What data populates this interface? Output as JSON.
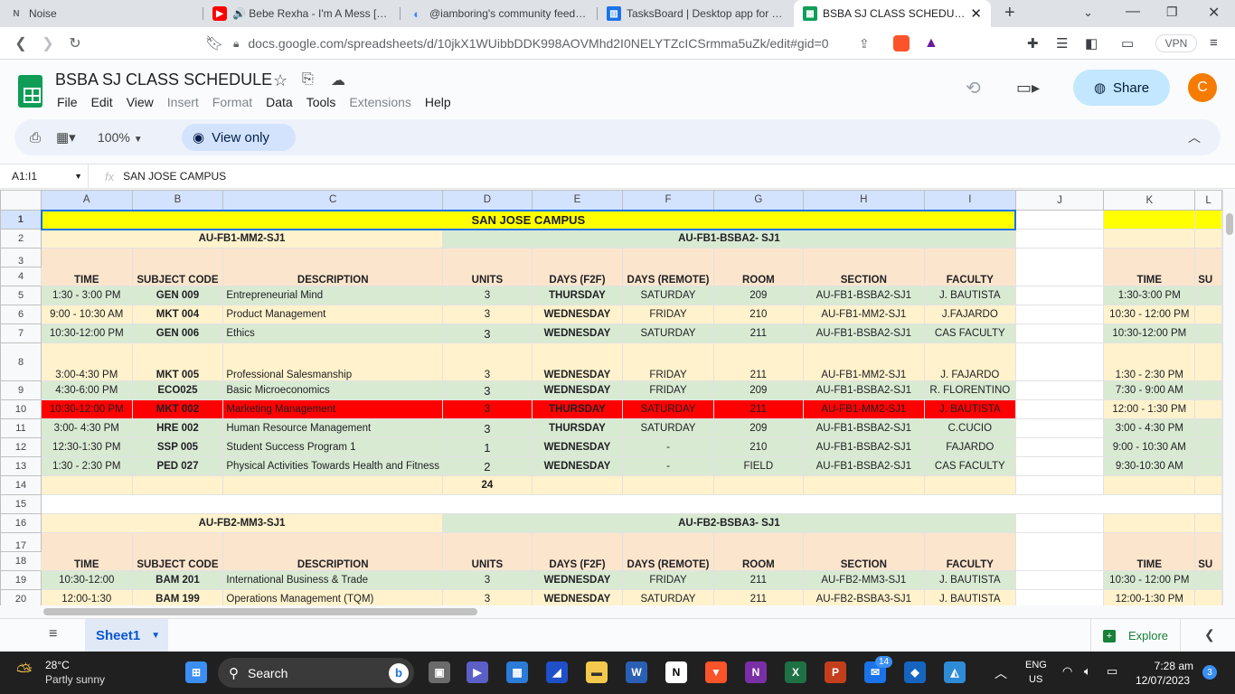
{
  "browser": {
    "tabs": [
      {
        "title": "Noise",
        "icon": "N"
      },
      {
        "title": "🔊 Bebe Rexha - I'm A Mess [Offic",
        "icon": "▶"
      },
      {
        "title": "@iamboring's community feed on",
        "icon": "◐"
      },
      {
        "title": "TasksBoard | Desktop app for Goo",
        "icon": "▥"
      },
      {
        "title": "BSBA SJ CLASS SCHEDULE - G",
        "icon": "▦"
      }
    ],
    "url": "docs.google.com/spreadsheets/d/10jkX1WUibbDDK998AOVMhd2I0NELYTZcICSrmma5uZk/edit#gid=0",
    "vpn_label": "VPN"
  },
  "doc": {
    "title": "BSBA SJ CLASS SCHEDULE",
    "menus": [
      "File",
      "Edit",
      "View",
      "Insert",
      "Format",
      "Data",
      "Tools",
      "Extensions",
      "Help"
    ],
    "menus_disabled": [
      false,
      false,
      false,
      true,
      true,
      false,
      false,
      true,
      false
    ],
    "share_label": "Share",
    "avatar_letter": "C",
    "zoom": "100%",
    "view_only_label": "View only"
  },
  "formula_bar": {
    "cell_ref": "A1:I1",
    "fx": "fx",
    "content": "SAN JOSE CAMPUS"
  },
  "columns": [
    "A",
    "B",
    "C",
    "D",
    "E",
    "F",
    "G",
    "H",
    "I",
    "J",
    "K",
    "L"
  ],
  "sheet": {
    "campus": "SAN JOSE CAMPUS",
    "section1_left": "AU-FB1-MM2-SJ1",
    "section1_right": "AU-FB1-BSBA2- SJ1",
    "section2_left": "AU-FB2-MM3-SJ1",
    "section2_right": "AU-FB2-BSBA3- SJ1",
    "headers": [
      "TIME",
      "SUBJECT CODE",
      "DESCRIPTION",
      "UNITS",
      "DAYS (F2F)",
      "DAYS (REMOTE)",
      "ROOM",
      "SECTION",
      "FACULTY"
    ],
    "k_header": "TIME",
    "l_header": "SU",
    "rows1": [
      {
        "r": "5",
        "cells": [
          "1:30 - 3:00  PM",
          "GEN 009",
          "Entrepreneurial Mind",
          "3",
          "THURSDAY",
          "SATURDAY",
          "209",
          "AU-FB1-BSBA2-SJ1",
          "J. BAUTISTA"
        ],
        "k": "1:30-3:00 PM",
        "style": "sage"
      },
      {
        "r": "6",
        "cells": [
          "9:00 - 10:30 AM",
          "MKT 004",
          "Product Management",
          "3",
          "WEDNESDAY",
          "FRIDAY",
          "210",
          "AU-FB1-MM2-SJ1",
          "J.FAJARDO"
        ],
        "k": "10:30 - 12:00 PM",
        "style": "cream"
      },
      {
        "r": "7",
        "cells": [
          "10:30-12:00 PM",
          "GEN 006",
          "Ethics",
          "3",
          "WEDNESDAY",
          "SATURDAY",
          "211",
          "AU-FB1-BSBA2-SJ1",
          "CAS FACULTY"
        ],
        "k": "10:30-12:00 PM",
        "style": "sage"
      },
      {
        "r": "8",
        "cells": [
          "3:00-4:30 PM",
          "MKT 005",
          "Professional Salesmanship",
          "3",
          "WEDNESDAY",
          "FRIDAY",
          "211",
          "AU-FB1-MM2-SJ1",
          "J. FAJARDO"
        ],
        "k": "1:30 - 2:30 PM",
        "style": "cream",
        "tall": true
      },
      {
        "r": "9",
        "cells": [
          "4:30-6:00 PM",
          "ECO025",
          "Basic Microeconomics",
          "3",
          "WEDNESDAY",
          "FRIDAY",
          "209",
          "AU-FB1-BSBA2-SJ1",
          "R. FLORENTINO"
        ],
        "k": "7:30 - 9:00 AM",
        "style": "sage"
      },
      {
        "r": "10",
        "cells": [
          "10:30-12:00 PM",
          "MKT 002",
          "Marketing Management",
          "3",
          "THURSDAY",
          "SATURDAY",
          "211",
          "AU-FB1-MM2-SJ1",
          "J. BAUTISTA"
        ],
        "k": "12:00 - 1:30 PM",
        "style": "red"
      },
      {
        "r": "11",
        "cells": [
          "3:00- 4:30 PM",
          "HRE 002",
          "Human Resource Management",
          "3",
          "THURSDAY",
          "SATURDAY",
          "209",
          "AU-FB1-BSBA2-SJ1",
          "C.CUCIO"
        ],
        "k": "3:00 - 4:30 PM",
        "style": "sage"
      },
      {
        "r": "12",
        "cells": [
          "12:30-1:30 PM",
          "SSP 005",
          "Student Success Program 1",
          "1",
          "WEDNESDAY",
          "-",
          "210",
          "AU-FB1-BSBA2-SJ1",
          "FAJARDO"
        ],
        "k": "9:00 - 10:30 AM",
        "style": "sage"
      },
      {
        "r": "13",
        "cells": [
          "1:30 - 2:30 PM",
          "PED 027",
          "Physical Activities Towards Health and Fitness",
          "2",
          "WEDNESDAY",
          "-",
          "FIELD",
          "AU-FB1-BSBA2-SJ1",
          "CAS FACULTY"
        ],
        "k": "9:30-10:30 AM",
        "style": "sage"
      }
    ],
    "total_units": "24",
    "rows2": [
      {
        "r": "19",
        "cells": [
          "10:30-12:00",
          "BAM 201",
          "International Business & Trade",
          "3",
          "WEDNESDAY",
          "FRIDAY",
          "211",
          "AU-FB2-MM3-SJ1",
          "J. BAUTISTA"
        ],
        "k": "10:30 - 12:00 PM",
        "style": "sage"
      },
      {
        "r": "20",
        "cells": [
          "12:00-1:30",
          "BAM 199",
          "Operations Management (TQM)",
          "3",
          "WEDNESDAY",
          "SATURDAY",
          "211",
          "AU-FB2-BSBA3-SJ1",
          "J. BAUTISTA"
        ],
        "k": "12:00-1:30 PM",
        "style": "cream"
      }
    ],
    "row_labels": [
      "1",
      "2",
      "3",
      "4",
      "14",
      "15",
      "16",
      "17",
      "18"
    ]
  },
  "sheetbar": {
    "tab": "Sheet1",
    "explore": "Explore"
  },
  "taskbar": {
    "weather_temp": "28°C",
    "weather_desc": "Partly sunny",
    "search": "Search",
    "lang1": "ENG",
    "lang2": "US",
    "time": "7:28 am",
    "date": "12/07/2023",
    "badge": "14",
    "notif": "3"
  }
}
